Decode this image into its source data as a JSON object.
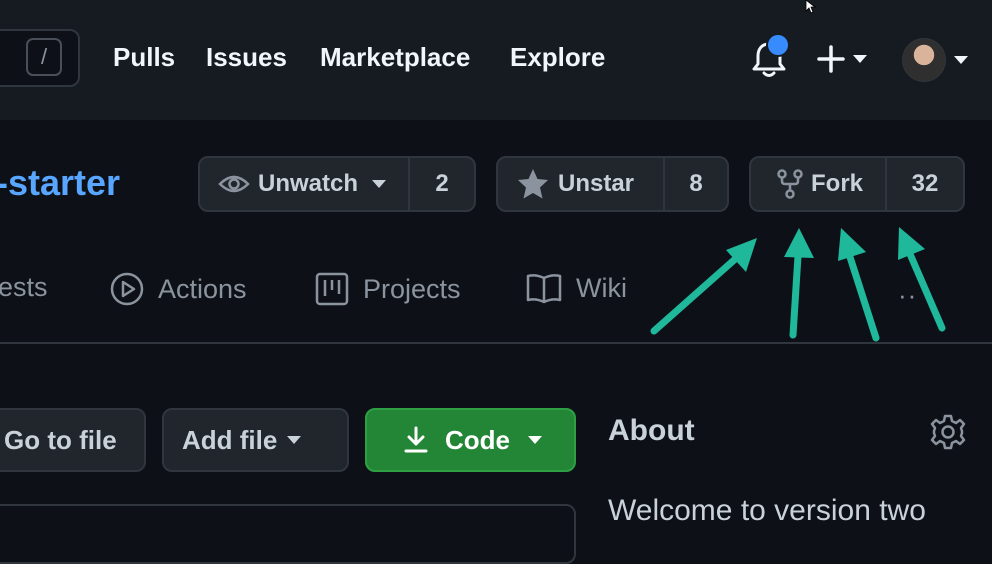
{
  "header": {
    "slash_key": "/",
    "nav": [
      "Pulls",
      "Issues",
      "Marketplace",
      "Explore"
    ]
  },
  "repo": {
    "name_fragment": "-starter",
    "watch": {
      "label": "Unwatch",
      "count": "2"
    },
    "star": {
      "label": "Unstar",
      "count": "8"
    },
    "fork": {
      "label": "Fork",
      "count": "32"
    }
  },
  "tabs": [
    {
      "label": "ests",
      "icon": "pull-request-icon"
    },
    {
      "label": "Actions",
      "icon": "play-icon"
    },
    {
      "label": "Projects",
      "icon": "project-icon"
    },
    {
      "label": "Wiki",
      "icon": "book-icon"
    }
  ],
  "overflow_dots": "··",
  "toolbar": {
    "go_to_file": "Go to file",
    "add_file": "Add file",
    "code": "Code"
  },
  "about": {
    "title": "About",
    "description": "Welcome to version two"
  },
  "colors": {
    "link": "#58a6ff",
    "code_button": "#238636",
    "annotation_arrow": "#1fb89b",
    "notification": "#388bfd"
  }
}
